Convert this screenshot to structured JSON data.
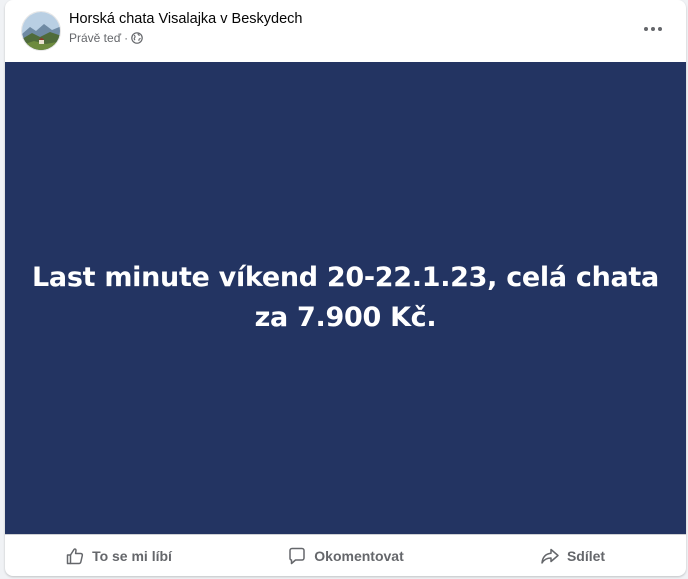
{
  "post": {
    "author": "Horská chata Visalajka v Beskydech",
    "time": "Právě teď",
    "separator": "·",
    "text": "Last minute víkend 20-22.1.23, celá chata za 7.900 Kč."
  },
  "actions": {
    "like": "To se mi líbí",
    "comment": "Okomentovat",
    "share": "Sdílet"
  },
  "icons": {
    "avatar": "mountain-landscape-avatar",
    "audience": "globe-icon",
    "more": "more-dots-icon",
    "like": "thumbs-up-icon",
    "comment": "comment-bubble-icon",
    "share": "share-arrow-icon"
  },
  "colors": {
    "post_background": "#233462",
    "post_text": "#ffffff",
    "secondary_text": "#65676b"
  }
}
